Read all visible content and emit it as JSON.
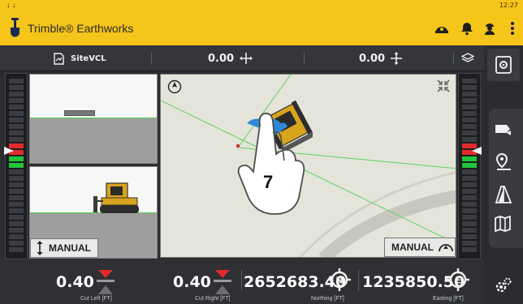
{
  "status_bar": {
    "clock": "12:27",
    "indicators": "↓ ↓"
  },
  "app_bar": {
    "title": "Trimble® Earthworks",
    "icons": [
      "helmet-icon",
      "bell-icon",
      "operator-icon",
      "overflow-menu-icon"
    ]
  },
  "info_bar": {
    "design_name": "SiteVCL",
    "cross_slope_value": "0.00",
    "main_fall_value": "0.00",
    "icons": [
      "design-file-icon",
      "cross-slope-icon",
      "main-fall-icon",
      "layers-icon"
    ]
  },
  "side_views": {
    "top_view_label": "",
    "bottom_view_label": "MANUAL"
  },
  "plan_view": {
    "mode_label": "MANUAL",
    "gesture_hint_number": "7"
  },
  "bottom_bar": {
    "cut_left": {
      "value": "0.40",
      "label": "Cut Left  [FT]"
    },
    "cut_right": {
      "value": "0.40",
      "label": "Cut Right  [FT]"
    },
    "northing": {
      "value": "2652683.40",
      "label": "Northing  [FT]",
      "badge": "N"
    },
    "easting": {
      "value": "1235850.50",
      "label": "Easting  [FT]",
      "badge": "E"
    }
  },
  "right_rail": {
    "items": [
      "settings-panel-icon",
      "view-toggle-icon",
      "point-nav-icon",
      "road-icon",
      "map-icon",
      "machine-settings-icon"
    ]
  },
  "colors": {
    "accent": "#f5c51a",
    "on_grade_green": "#21c43a",
    "cut_red": "#e12b2b"
  }
}
